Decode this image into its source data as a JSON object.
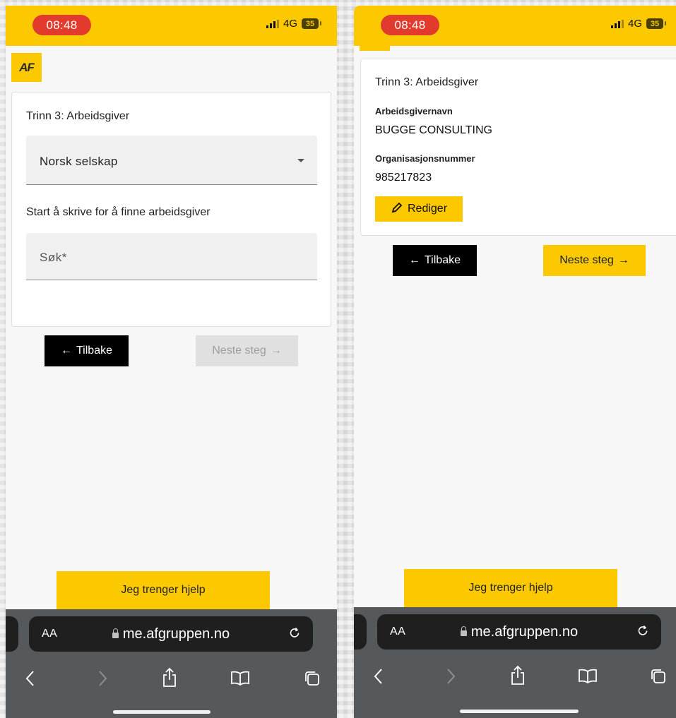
{
  "status": {
    "time": "08:48",
    "network": "4G",
    "battery": "35"
  },
  "left": {
    "logo_text": "AF",
    "step_title": "Trinn 3: Arbeidsgiver",
    "company_type": "Norsk selskap",
    "search_hint": "Start å skrive for å finne arbeidsgiver",
    "search_placeholder": "Søk*",
    "back_label": "Tilbake",
    "next_label": "Neste steg",
    "next_enabled": false
  },
  "right": {
    "step_title": "Trinn 3: Arbeidsgiver",
    "employer_name_label": "Arbeidsgivernavn",
    "employer_name": "BUGGE CONSULTING",
    "org_number_label": "Organisasjonsnummer",
    "org_number": "985217823",
    "edit_label": "Rediger",
    "back_label": "Tilbake",
    "next_label": "Neste steg",
    "next_enabled": true
  },
  "help_label": "Jeg trenger hjelp",
  "browser": {
    "text_size_label": "AA",
    "url": "me.afgruppen.no"
  },
  "colors": {
    "brand_yellow": "#fcc800",
    "time_pill": "#e23b2e",
    "back_button": "#000000",
    "disabled_button": "#e0e0e0"
  },
  "icons": [
    "pencil-icon",
    "arrow-left-icon",
    "arrow-right-icon",
    "lock-icon",
    "reload-icon",
    "back-nav-icon",
    "forward-nav-icon",
    "share-icon",
    "bookmarks-icon",
    "tabs-icon",
    "dropdown-caret-icon"
  ]
}
